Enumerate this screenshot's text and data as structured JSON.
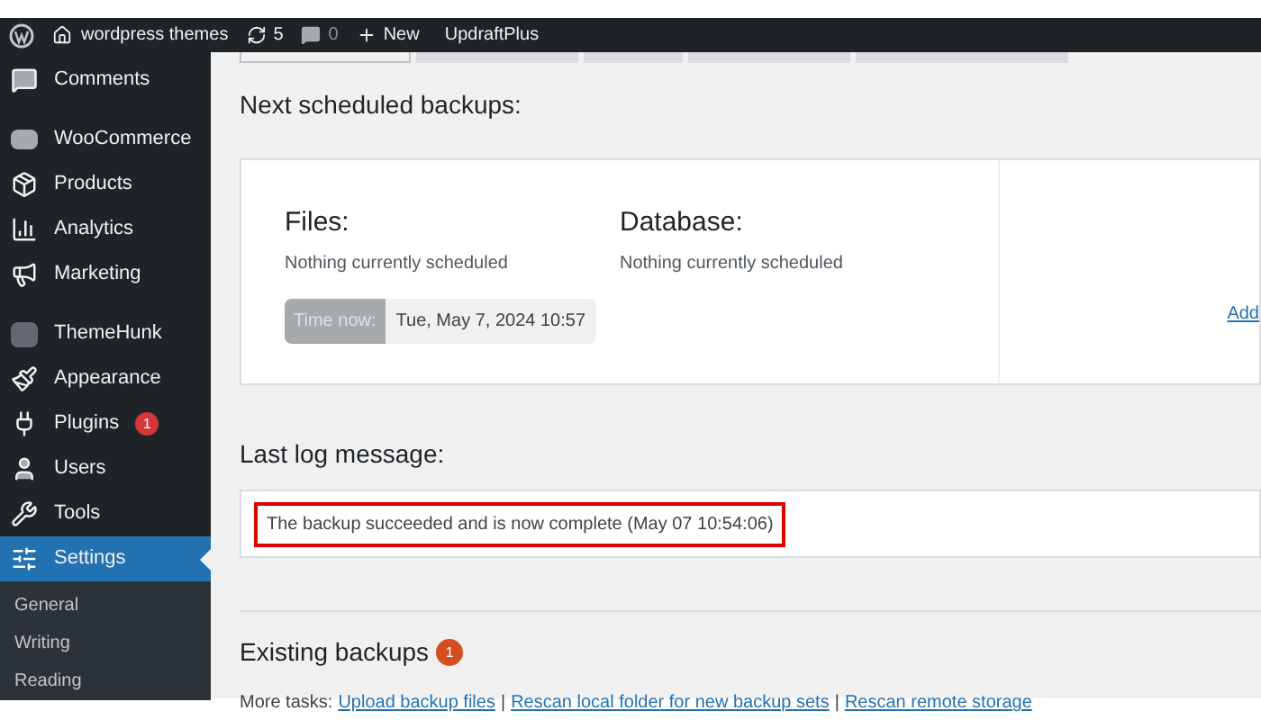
{
  "admin_bar": {
    "site_name": "wordpress themes",
    "updates": "5",
    "comments": "0",
    "new_label": "New",
    "plugin_link": "UpdraftPlus"
  },
  "sidebar": {
    "items": [
      {
        "label": "Comments",
        "kind": "comment",
        "selected": false
      },
      {
        "label": "WooCommerce",
        "kind": "woo",
        "selected": false
      },
      {
        "label": "Products",
        "kind": "box",
        "selected": false
      },
      {
        "label": "Analytics",
        "kind": "bars",
        "selected": false
      },
      {
        "label": "Marketing",
        "kind": "megaphone",
        "selected": false
      },
      {
        "label": "ThemeHunk",
        "kind": "th",
        "selected": false
      },
      {
        "label": "Appearance",
        "kind": "brush",
        "selected": false
      },
      {
        "label": "Plugins",
        "kind": "plug",
        "selected": false,
        "badge": "1"
      },
      {
        "label": "Users",
        "kind": "user",
        "selected": false
      },
      {
        "label": "Tools",
        "kind": "wrench",
        "selected": false
      },
      {
        "label": "Settings",
        "kind": "settings",
        "selected": true
      }
    ],
    "submenu": [
      "General",
      "Writing",
      "Reading"
    ]
  },
  "tabs": [
    {
      "selected": true
    },
    {
      "selected": false
    },
    {
      "selected": false
    },
    {
      "selected": false
    },
    {
      "selected": false
    }
  ],
  "scheduled": {
    "heading": "Next scheduled backups:",
    "files_label": "Files:",
    "files_status": "Nothing currently scheduled",
    "database_label": "Database:",
    "database_status": "Nothing currently scheduled",
    "time_now_label": "Time now:",
    "time_now_value": "Tue, May 7, 2024 10:57",
    "side_link": "Add"
  },
  "log": {
    "heading": "Last log message:",
    "message": "The backup succeeded and is now complete (May 07 10:54:06)"
  },
  "existing": {
    "heading": "Existing backups",
    "count": "1"
  },
  "more_tasks": {
    "label": "More tasks:",
    "separators": [
      "|",
      "|"
    ],
    "links": [
      "Upload backup files",
      "Rescan local folder for new backup sets",
      "Rescan remote storage"
    ]
  }
}
